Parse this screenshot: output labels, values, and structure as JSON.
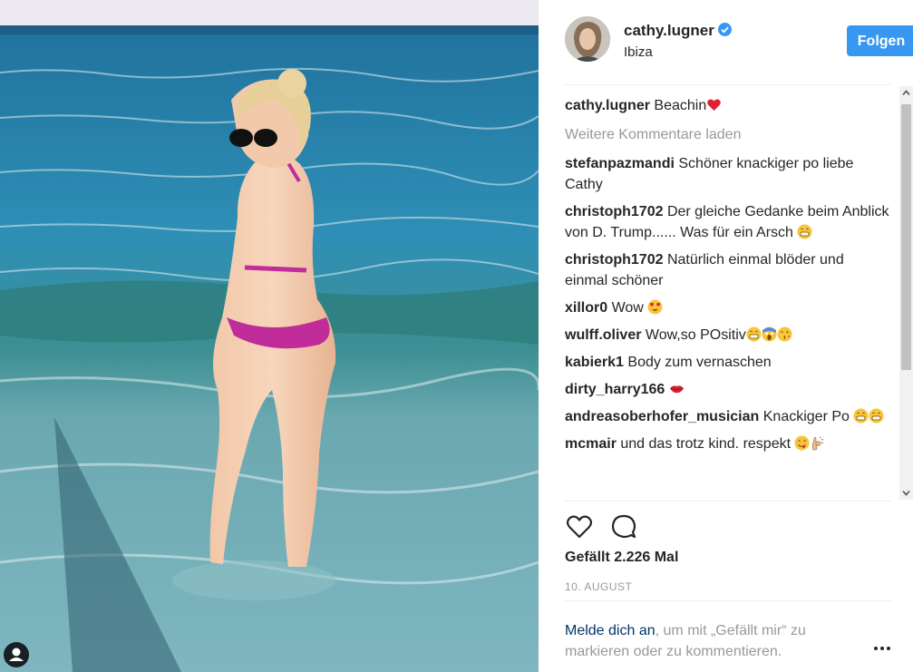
{
  "post": {
    "username": "cathy.lugner",
    "location": "Ibiza",
    "follow_label": "Folgen",
    "caption_user": "cathy.lugner",
    "caption_text": "Beachin",
    "load_more": "Weitere Kommentare laden",
    "comments": [
      {
        "user": "stefanpazmandi",
        "text": "Schöner knackiger po liebe Cathy"
      },
      {
        "user": "christoph1702",
        "text": "Der gleiche Gedanke beim Anblick von D. Trump...... Was für ein Arsch"
      },
      {
        "user": "christoph1702",
        "text": "Natürlich einmal blöder und einmal schöner"
      },
      {
        "user": "xillor0",
        "text": "Wow"
      },
      {
        "user": "wulff.oliver",
        "text": "Wow,so POsitiv"
      },
      {
        "user": "kabierk1",
        "text": "Body zum vernaschen"
      },
      {
        "user": "dirty_harry166",
        "text": ""
      },
      {
        "user": "andreasoberhofer_musician",
        "text": "Knackiger Po"
      },
      {
        "user": "mcmair",
        "text": "und das trotz kind. respekt"
      }
    ],
    "likes": "Gefällt 2.226 Mal",
    "date": "10. AUGUST",
    "login_link": "Melde dich an",
    "login_rest": ", um mit „Gefällt mir“ zu markieren oder zu kommentieren.",
    "more_options": "•••"
  },
  "icons": {
    "verified": "verified-badge-icon",
    "heart": "heart-icon",
    "comment": "comment-icon",
    "user_tag": "user-tag-icon",
    "emoji_heart": "red-heart-emoji",
    "emoji_grin": "grinning-emoji",
    "emoji_heart_eyes": "heart-eyes-emoji",
    "emoji_scream": "screaming-emoji",
    "emoji_kiss": "kissing-emoji",
    "emoji_lips": "lips-emoji",
    "emoji_yum": "yum-emoji",
    "emoji_ok": "ok-hand-emoji"
  },
  "colors": {
    "follow_button": "#3897f0",
    "verified": "#3897f0",
    "muted": "#999999",
    "link": "#003569"
  }
}
